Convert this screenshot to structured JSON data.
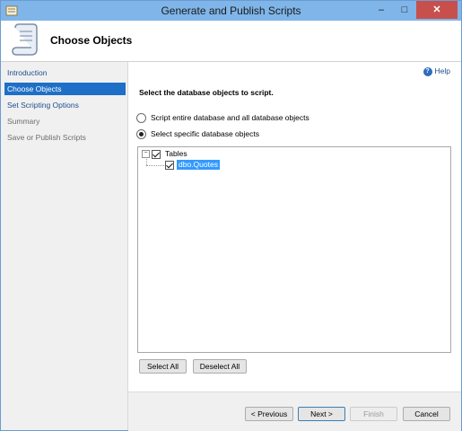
{
  "window": {
    "title": "Generate and Publish Scripts"
  },
  "titlebar_buttons": {
    "minimize": "–",
    "maximize": "□",
    "close": "✕"
  },
  "header": {
    "title": "Choose Objects",
    "icon": "scroll-icon"
  },
  "sidebar": {
    "items": [
      {
        "label": "Introduction",
        "state": "link"
      },
      {
        "label": "Choose Objects",
        "state": "active"
      },
      {
        "label": "Set Scripting Options",
        "state": "link"
      },
      {
        "label": "Summary",
        "state": "disabled"
      },
      {
        "label": "Save or Publish Scripts",
        "state": "disabled"
      }
    ]
  },
  "main": {
    "help_label": "Help",
    "prompt": "Select the database objects to script.",
    "options": [
      {
        "label": "Script entire database and all database objects",
        "checked": false
      },
      {
        "label": "Select specific database objects",
        "checked": true
      }
    ],
    "tree": {
      "root": {
        "label": "Tables",
        "checked": true,
        "expander": "−"
      },
      "children": [
        {
          "label": "dbo.Quotes",
          "checked": true,
          "selected": true
        }
      ]
    },
    "select_all_label": "Select All",
    "deselect_all_label": "Deselect All"
  },
  "footer": {
    "previous_label": "< Previous",
    "next_label": "Next >",
    "finish_label": "Finish",
    "cancel_label": "Cancel"
  },
  "colors": {
    "titlebar": "#7fb5e9",
    "selection": "#1e6fc7",
    "close": "#c7504d"
  }
}
